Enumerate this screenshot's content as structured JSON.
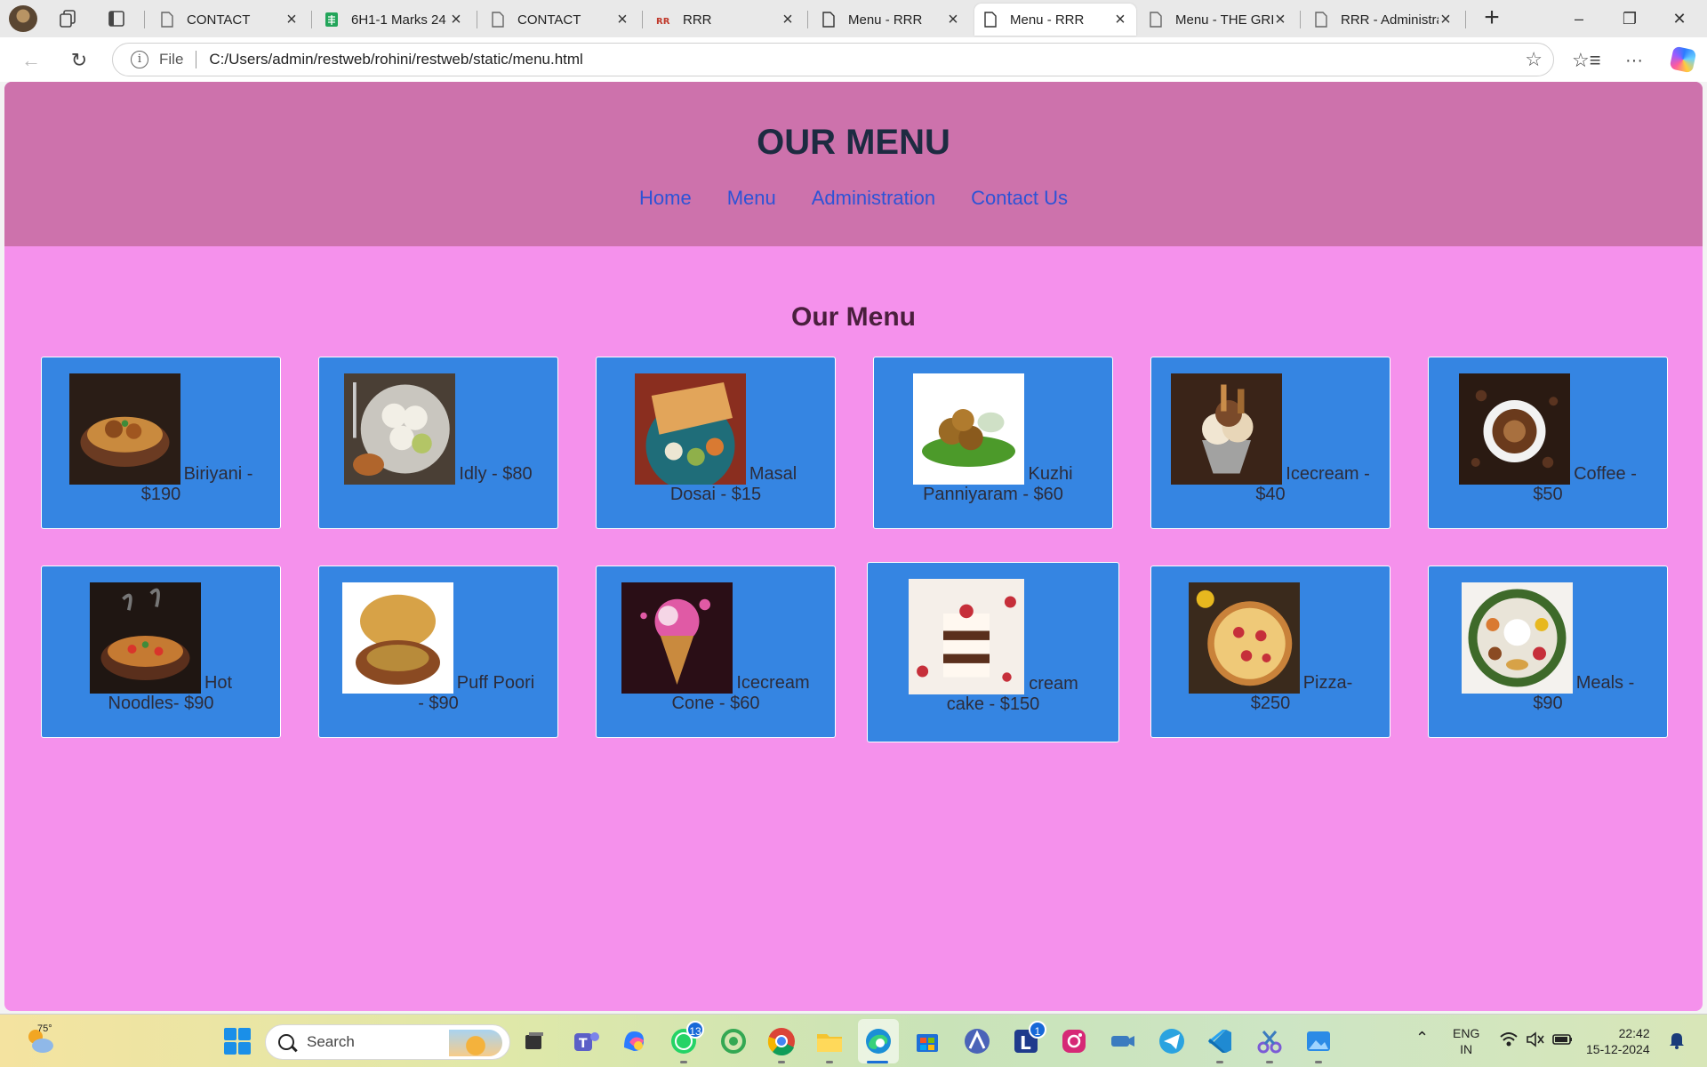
{
  "browser": {
    "tabs": [
      {
        "title": "CONTACT",
        "icon": "page-icon"
      },
      {
        "title": "6H1-1 Marks 24",
        "icon": "sheets-icon"
      },
      {
        "title": "CONTACT",
        "icon": "page-icon"
      },
      {
        "title": "RRR",
        "icon": "rrr-icon"
      },
      {
        "title": "Menu - RRR",
        "icon": "page-icon"
      },
      {
        "title": "Menu - RRR",
        "icon": "page-icon",
        "active": true
      },
      {
        "title": "Menu - THE GRI",
        "icon": "page-icon"
      },
      {
        "title": "RRR - Administra",
        "icon": "page-icon"
      }
    ],
    "close_glyph": "×",
    "new_tab_glyph": "+",
    "window_controls": {
      "minimize": "–",
      "maximize": "❐",
      "close": "✕"
    },
    "address": {
      "scheme_label": "File",
      "url": "C:/Users/admin/restweb/rohini/restweb/static/menu.html"
    }
  },
  "page": {
    "header_title": "OUR MENU",
    "nav": [
      "Home",
      "Menu",
      "Administration",
      "Contact Us"
    ],
    "section_title": "Our Menu",
    "items": [
      {
        "label": "Biriyani - $190",
        "image": "biriyani-image"
      },
      {
        "label": "Idly - $80",
        "image": "idly-image"
      },
      {
        "label": "Masal Dosai - $15",
        "image": "masal-dosai-image"
      },
      {
        "label": "Kuzhi Panniyaram - $60",
        "image": "kuzhi-panniyaram-image"
      },
      {
        "label": "Icecream - $40",
        "image": "icecream-image"
      },
      {
        "label": "Coffee - $50",
        "image": "coffee-image"
      },
      {
        "label": "Hot Noodles- $90",
        "image": "hot-noodles-image"
      },
      {
        "label": "Puff Poori - $90",
        "image": "puff-poori-image"
      },
      {
        "label": "Icecream Cone - $60",
        "image": "icecream-cone-image"
      },
      {
        "label": "cream cake - $150",
        "image": "cream-cake-image"
      },
      {
        "label": "Pizza- $250",
        "image": "pizza-image"
      },
      {
        "label": "Meals - $90",
        "image": "meals-image"
      }
    ],
    "colors": {
      "header_bg": "#cd72ac",
      "page_bg": "#f591ec",
      "card_bg": "#3585e2",
      "link": "#2d53d6"
    }
  },
  "taskbar": {
    "weather_temp": "75°",
    "search_placeholder": "Search",
    "whatsapp_badge": "13",
    "l_app_badge": "1",
    "lang_top": "ENG",
    "lang_bottom": "IN",
    "time": "22:42",
    "date": "15-12-2024"
  }
}
